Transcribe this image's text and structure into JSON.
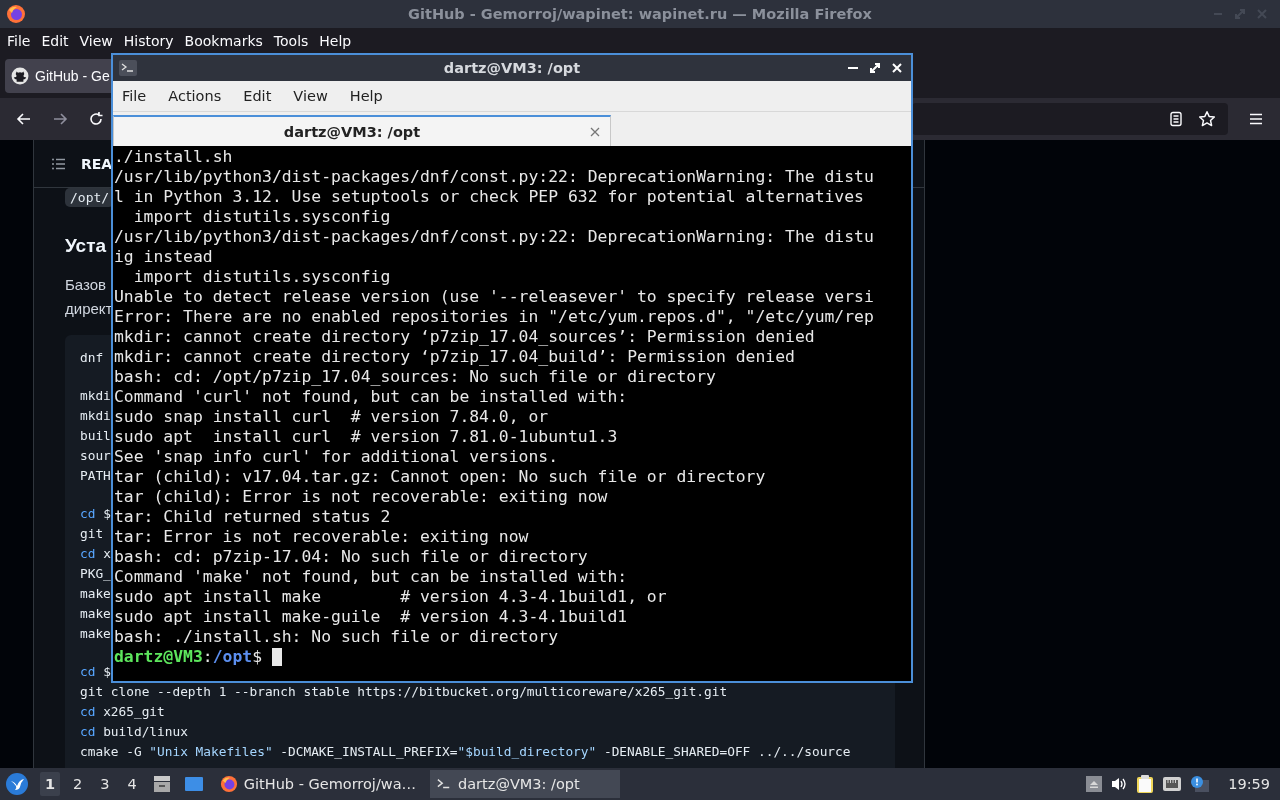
{
  "browser": {
    "title": "GitHub - Gemorroj/wapinet: wapinet.ru — Mozilla Firefox",
    "menu": [
      "File",
      "Edit",
      "View",
      "History",
      "Bookmarks",
      "Tools",
      "Help"
    ],
    "tabs": [
      {
        "label": "GitHub - Ge",
        "selected": true
      }
    ],
    "page": {
      "toc_label": "REA",
      "path_chip": "/opt/",
      "heading": "Уста",
      "paragraph_lines": [
        "Базов",
        "директ"
      ],
      "code_groups": [
        [
          [
            {
              "text": "dnf",
              "kind": "plain"
            }
          ]
        ],
        [
          [
            {
              "text": "mkdi",
              "kind": "plain"
            }
          ],
          [
            {
              "text": "mkdi",
              "kind": "plain"
            }
          ],
          [
            {
              "text": "buil",
              "kind": "plain"
            }
          ],
          [
            {
              "text": "sour",
              "kind": "plain"
            }
          ],
          [
            {
              "text": "PATH",
              "kind": "plain"
            }
          ]
        ],
        [
          [
            {
              "text": "cd",
              "kind": "keyword"
            },
            {
              "text": " $",
              "kind": "plain"
            }
          ],
          [
            {
              "text": "git",
              "kind": "plain"
            }
          ],
          [
            {
              "text": "cd",
              "kind": "keyword"
            },
            {
              "text": " x",
              "kind": "plain"
            }
          ],
          [
            {
              "text": "PKG_",
              "kind": "plain"
            }
          ],
          [
            {
              "text": "make",
              "kind": "plain"
            }
          ],
          [
            {
              "text": "make",
              "kind": "plain"
            }
          ],
          [
            {
              "text": "make",
              "kind": "plain"
            }
          ]
        ],
        [
          [
            {
              "text": "cd",
              "kind": "keyword"
            },
            {
              "text": " $",
              "kind": "plain"
            }
          ],
          [
            {
              "text": "git clone --depth 1 --branch stable https://bitbucket.org/multicoreware/x265_git.git",
              "kind": "plain"
            }
          ],
          [
            {
              "text": "cd",
              "kind": "keyword"
            },
            {
              "text": " x265_git",
              "kind": "plain"
            }
          ],
          [
            {
              "text": "cd",
              "kind": "keyword"
            },
            {
              "text": " build/linux",
              "kind": "plain"
            }
          ],
          [
            {
              "text": "cmake -G ",
              "kind": "plain"
            },
            {
              "text": "\"Unix Makefiles\"",
              "kind": "string"
            },
            {
              "text": " -DCMAKE_INSTALL_PREFIX=",
              "kind": "plain"
            },
            {
              "text": "\"$build_directory\"",
              "kind": "string"
            },
            {
              "text": " -DENABLE_SHARED=OFF ../../source",
              "kind": "plain"
            }
          ]
        ]
      ]
    }
  },
  "terminal": {
    "title": "dartz@VM3: /opt",
    "menu": [
      "File",
      "Actions",
      "Edit",
      "View",
      "Help"
    ],
    "tabs": [
      {
        "label": "dartz@VM3: /opt",
        "selected": true
      }
    ],
    "lines": [
      "./install.sh",
      "/usr/lib/python3/dist-packages/dnf/const.py:22: DeprecationWarning: The distu",
      "l in Python 3.12. Use setuptools or check PEP 632 for potential alternatives",
      "  import distutils.sysconfig",
      "/usr/lib/python3/dist-packages/dnf/const.py:22: DeprecationWarning: The distu",
      "ig instead",
      "  import distutils.sysconfig",
      "Unable to detect release version (use '--releasever' to specify release versi",
      "Error: There are no enabled repositories in \"/etc/yum.repos.d\", \"/etc/yum/rep",
      "mkdir: cannot create directory ‘p7zip_17.04_sources’: Permission denied",
      "mkdir: cannot create directory ‘p7zip_17.04_build’: Permission denied",
      "bash: cd: /opt/p7zip_17.04_sources: No such file or directory",
      "Command 'curl' not found, but can be installed with:",
      "sudo snap install curl  # version 7.84.0, or",
      "sudo apt  install curl  # version 7.81.0-1ubuntu1.3",
      "See 'snap info curl' for additional versions.",
      "tar (child): v17.04.tar.gz: Cannot open: No such file or directory",
      "tar (child): Error is not recoverable: exiting now",
      "tar: Child returned status 2",
      "tar: Error is not recoverable: exiting now",
      "bash: cd: p7zip-17.04: No such file or directory",
      "Command 'make' not found, but can be installed with:",
      "sudo apt install make        # version 4.3-4.1build1, or",
      "sudo apt install make-guile  # version 4.3-4.1build1",
      "bash: ./install.sh: No such file or directory"
    ],
    "prompt": [
      {
        "text": "dartz@VM3",
        "kind": "user"
      },
      {
        "text": ":",
        "kind": "plain"
      },
      {
        "text": "/opt",
        "kind": "path"
      },
      {
        "text": "$",
        "kind": "plain"
      }
    ]
  },
  "taskbar": {
    "workspaces": [
      {
        "label": "1",
        "selected": true
      },
      {
        "label": "2",
        "selected": false
      },
      {
        "label": "3",
        "selected": false
      },
      {
        "label": "4",
        "selected": false
      }
    ],
    "tasks": [
      {
        "label": "GitHub - Gemorroj/wa…",
        "kind": "browser",
        "selected": false
      },
      {
        "label": "dartz@VM3: /opt",
        "kind": "terminal",
        "selected": true
      }
    ],
    "clock": "19:59"
  }
}
